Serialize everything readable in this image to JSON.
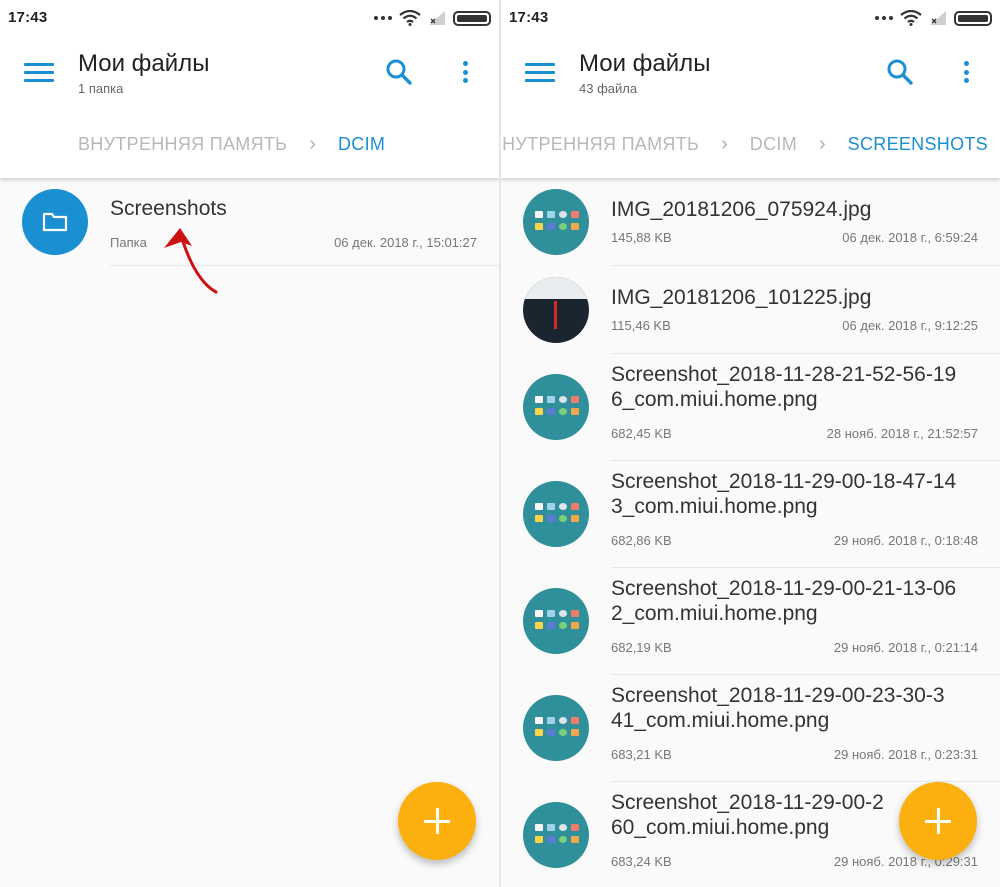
{
  "colors": {
    "accent": "#1a8fd1",
    "fab": "#fbb00f",
    "arrow": "#cc1111"
  },
  "left": {
    "status": {
      "time": "17:43"
    },
    "title": "Мои файлы",
    "subtitle": "1 папка",
    "breadcrumb": [
      "ВНУТРЕННЯЯ ПАМЯТЬ",
      "DCIM"
    ],
    "items": [
      {
        "name": "Screenshots",
        "type": "Папка",
        "date": "06 дек. 2018 г., 15:01:27",
        "icon": "folder-icon"
      }
    ]
  },
  "right": {
    "status": {
      "time": "17:43"
    },
    "title": "Мои файлы",
    "subtitle": "43 файла",
    "breadcrumb": [
      "ВНУТРЕННЯЯ ПАМЯТЬ",
      "DCIM",
      "SCREENSHOTS"
    ],
    "items": [
      {
        "line1": "IMG_20181206_075924.jpg",
        "line2": "",
        "size": "145,88 KB",
        "date": "06 дек. 2018 г., 6:59:24",
        "thumb": "home"
      },
      {
        "line1": "IMG_20181206_101225.jpg",
        "line2": "",
        "size": "115,46 KB",
        "date": "06 дек. 2018 г., 9:12:25",
        "thumb": "dark"
      },
      {
        "line1": "Screenshot_2018-11-28-21-52-56-19",
        "line2": "6_com.miui.home.png",
        "size": "682,45 KB",
        "date": "28 нояб. 2018 г., 21:52:57",
        "thumb": "home"
      },
      {
        "line1": "Screenshot_2018-11-29-00-18-47-14",
        "line2": "3_com.miui.home.png",
        "size": "682,86 KB",
        "date": "29 нояб. 2018 г., 0:18:48",
        "thumb": "home"
      },
      {
        "line1": "Screenshot_2018-11-29-00-21-13-06",
        "line2": "2_com.miui.home.png",
        "size": "682,19 KB",
        "date": "29 нояб. 2018 г., 0:21:14",
        "thumb": "home"
      },
      {
        "line1": "Screenshot_2018-11-29-00-23-30-3",
        "line2": "41_com.miui.home.png",
        "size": "683,21 KB",
        "date": "29 нояб. 2018 г., 0:23:31",
        "thumb": "home"
      },
      {
        "line1": "Screenshot_2018-11-29-00-2",
        "line2": "60_com.miui.home.png",
        "size": "683,24 KB",
        "date": "29 нояб. 2018 г., 0:29:31",
        "thumb": "home"
      }
    ]
  }
}
